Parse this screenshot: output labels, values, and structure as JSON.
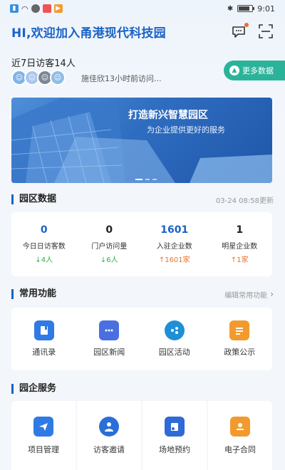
{
  "status_bar": {
    "time": "9:01"
  },
  "header": {
    "title": "HI,欢迎加入甬港现代科技园"
  },
  "visitors": {
    "title": "近7日访客14人",
    "note": "施佳欣13小时前访问...",
    "more_button": "更多数据"
  },
  "banner": {
    "headline": "打造新兴智慧园区",
    "tagline": "为企业提供更好的服务"
  },
  "park_data": {
    "title": "园区数据",
    "updated": "03-24 08:58更新",
    "stats": [
      {
        "value": "0",
        "label": "今日日访客数",
        "trend": "↓4人",
        "color": "#1b63c6",
        "trend_color": "#2bb34a"
      },
      {
        "value": "0",
        "label": "门户访问量",
        "trend": "↓6人",
        "color": "#222222",
        "trend_color": "#2bb34a"
      },
      {
        "value": "1601",
        "label": "入驻企业数",
        "trend": "↑1601家",
        "color": "#1b63c6",
        "trend_color": "#e8742b"
      },
      {
        "value": "1",
        "label": "明星企业数",
        "trend": "↑1家",
        "color": "#222222",
        "trend_color": "#e8742b"
      }
    ]
  },
  "functions": {
    "title": "常用功能",
    "edit_label": "编辑常用功能",
    "items": [
      {
        "label": "通讯录",
        "icon": "contacts-icon",
        "color": "#2f7ae5"
      },
      {
        "label": "园区新闻",
        "icon": "news-icon",
        "color": "#4a6fe0"
      },
      {
        "label": "园区活动",
        "icon": "activity-icon",
        "color": "#1f8fd6"
      },
      {
        "label": "政策公示",
        "icon": "policy-icon",
        "color": "#f29a2e"
      }
    ]
  },
  "services": {
    "title": "园企服务",
    "items": [
      {
        "label": "项目管理",
        "icon": "project-icon",
        "color": "#2f7ae5"
      },
      {
        "label": "访客邀请",
        "icon": "visitor-invite-icon",
        "color": "#2a6fd8"
      },
      {
        "label": "场地预约",
        "icon": "venue-booking-icon",
        "color": "#2f6ad6"
      },
      {
        "label": "电子合同",
        "icon": "contract-icon",
        "color": "#f29a2e"
      }
    ]
  }
}
